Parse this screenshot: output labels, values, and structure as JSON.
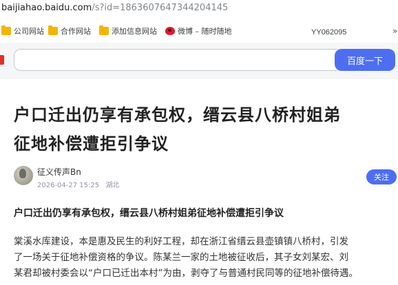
{
  "browser": {
    "url_host": "baijiahao.baidu.com",
    "url_path": "/s?id=1863607647344204145"
  },
  "bookmarks": [
    {
      "label": "公司网站",
      "icon": "folder-icon"
    },
    {
      "label": "合作网站",
      "icon": "folder-icon"
    },
    {
      "label": "添加信息网站",
      "icon": "folder-icon"
    },
    {
      "label": "微博 – 随时随地",
      "icon": "weibo-icon"
    }
  ],
  "bookmarks_user_id": "YY062095",
  "search": {
    "value": "",
    "placeholder": "",
    "button_label": "百度一下"
  },
  "article": {
    "title_line1": "户口迁出仍享有承包权，缙云县八桥村姐弟",
    "title_line2": "征地补偿遭拒引争议",
    "author": "征义传声Bn",
    "date": "2026-04-27 15:25",
    "location": "湖北",
    "follow_label": "关注",
    "subheading": "户口迁出仍享有承包权，缙云县八桥村姐弟征地补偿遭拒引争议",
    "paragraph_lines": [
      "棠溪水库建设，本是惠及民生的利好工程，却在浙江省缙云县壶镇镇八桥村，引发",
      "了一场关于征地补偿资格的争议。陈某兰一家的土地被征收后，其子女刘某宏、刘",
      "某君却被村委会以“户口已迁出本村”为由，剥夺了与普通村民同等的征地补偿待遇。"
    ]
  },
  "colors": {
    "accent": "#4e6ef2",
    "folder": "#f5b400"
  }
}
